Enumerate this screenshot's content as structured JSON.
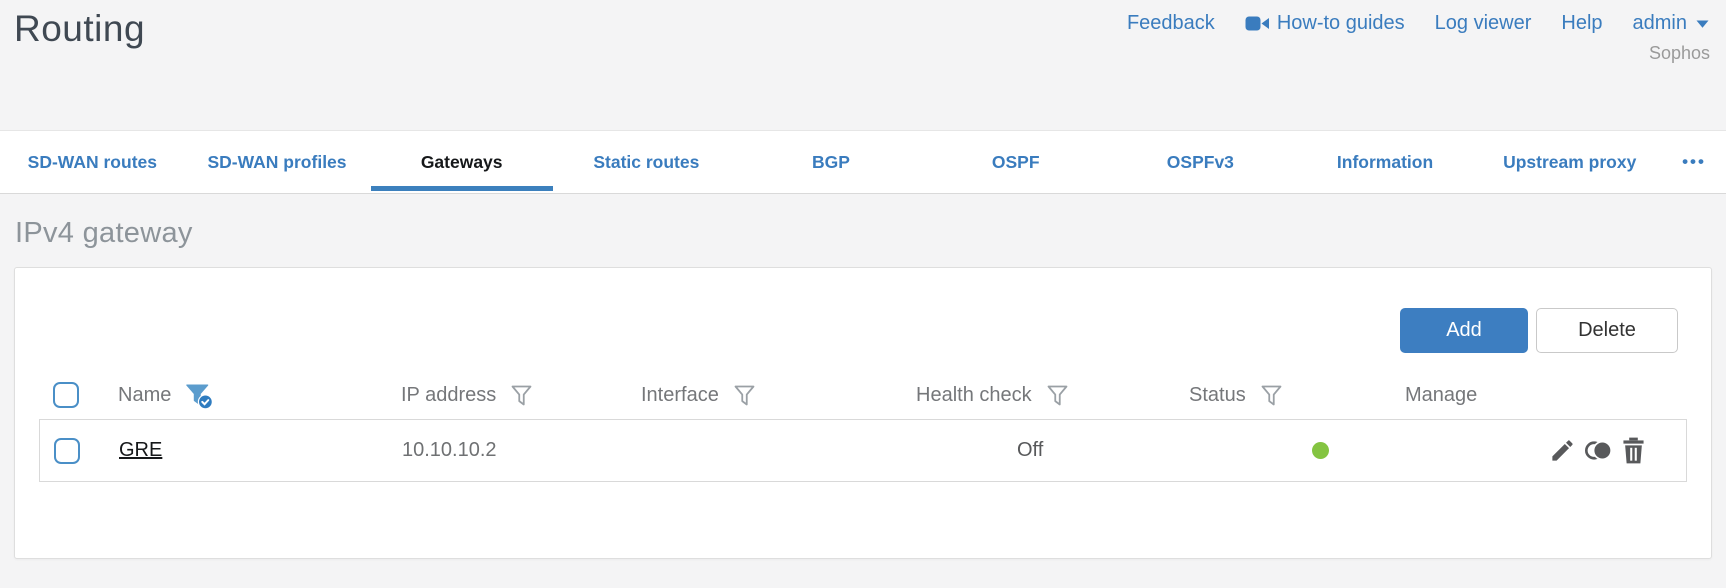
{
  "header": {
    "title": "Routing",
    "nav": [
      {
        "label": "Feedback"
      },
      {
        "label": "How-to guides",
        "icon": "video-camera-icon"
      },
      {
        "label": "Log viewer"
      },
      {
        "label": "Help"
      },
      {
        "label": "admin",
        "icon": "caret-down-icon"
      }
    ],
    "brand": "Sophos"
  },
  "tabs": {
    "items": [
      {
        "label": "SD-WAN routes",
        "active": false
      },
      {
        "label": "SD-WAN profiles",
        "active": false
      },
      {
        "label": "Gateways",
        "active": true
      },
      {
        "label": "Static routes",
        "active": false
      },
      {
        "label": "BGP",
        "active": false
      },
      {
        "label": "OSPF",
        "active": false
      },
      {
        "label": "OSPFv3",
        "active": false
      },
      {
        "label": "Information",
        "active": false
      },
      {
        "label": "Upstream proxy",
        "active": false
      }
    ],
    "more_label": "•••"
  },
  "section": {
    "title": "IPv4 gateway"
  },
  "toolbar": {
    "add_label": "Add",
    "delete_label": "Delete"
  },
  "table": {
    "columns": [
      {
        "label": "Name",
        "filter": "active"
      },
      {
        "label": "IP address",
        "filter": "inactive"
      },
      {
        "label": "Interface",
        "filter": "inactive"
      },
      {
        "label": "Health check",
        "filter": "inactive"
      },
      {
        "label": "Status",
        "filter": "inactive"
      },
      {
        "label": "Manage",
        "filter": "none"
      }
    ],
    "rows": [
      {
        "name": "GRE",
        "ip_address": "10.10.10.2",
        "interface": "",
        "health_check": "Off",
        "status": "up",
        "status_color": "#84c441",
        "manage_icons": [
          "edit-icon",
          "clone-icon",
          "delete-icon"
        ]
      }
    ]
  },
  "colors": {
    "accent_blue": "#3a7cbe",
    "button_blue": "#3d7ec1",
    "status_green": "#84c441",
    "active_tab_underline": "#3c80bd",
    "icon_gray": "#58595b"
  }
}
